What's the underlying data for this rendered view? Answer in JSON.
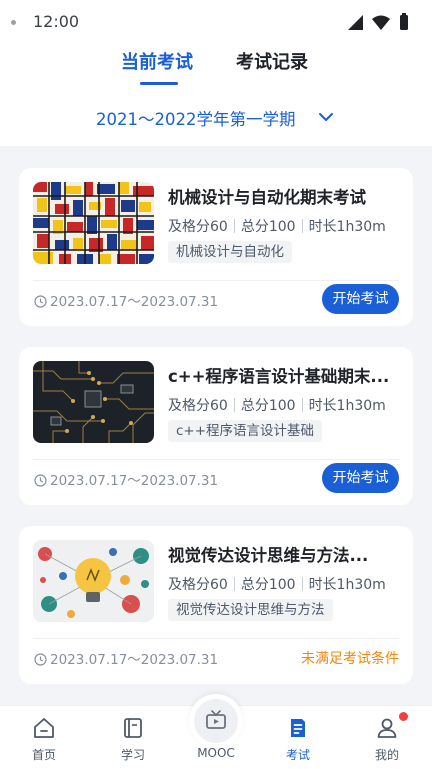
{
  "status_bar": {
    "time": "12:00"
  },
  "tabs": [
    {
      "label": "当前考试",
      "active": true
    },
    {
      "label": "考试记录",
      "active": false
    }
  ],
  "term": {
    "label": "2021～2022学年第一学期"
  },
  "exams": [
    {
      "title": "机械设计与自动化期末考试",
      "pass_label": "及格分60",
      "total_label": "总分100",
      "duration_label": "时长1h30m",
      "tag": "机械设计与自动化",
      "date_range": "2023.07.17～2023.07.31",
      "action": "开始考试",
      "image": "mondrian-art-thumbnail"
    },
    {
      "title": "c++程序语言设计基础期末...",
      "pass_label": "及格分60",
      "total_label": "总分100",
      "duration_label": "时长1h30m",
      "tag": "c++程序语言设计基础",
      "date_range": "2023.07.17～2023.07.31",
      "action": "开始考试",
      "image": "circuit-board-thumbnail"
    },
    {
      "title": "视觉传达设计思维与方法...",
      "pass_label": "及格分60",
      "total_label": "总分100",
      "duration_label": "时长1h30m",
      "tag": "视觉传达设计思维与方法",
      "date_range": "2023.07.17～2023.07.31",
      "status": "未满足考试条件",
      "image": "lightbulb-illustration-thumbnail"
    }
  ],
  "bottom_nav": [
    {
      "label": "首页",
      "icon": "home-icon"
    },
    {
      "label": "学习",
      "icon": "book-icon"
    },
    {
      "label": "MOOC",
      "icon": "tv-icon"
    },
    {
      "label": "考试",
      "icon": "exam-icon",
      "active": true
    },
    {
      "label": "我的",
      "icon": "user-icon",
      "badge": true
    }
  ],
  "colors": {
    "accent": "#1a5fd6",
    "warning": "#f2870f",
    "badge": "#f53f3f"
  }
}
